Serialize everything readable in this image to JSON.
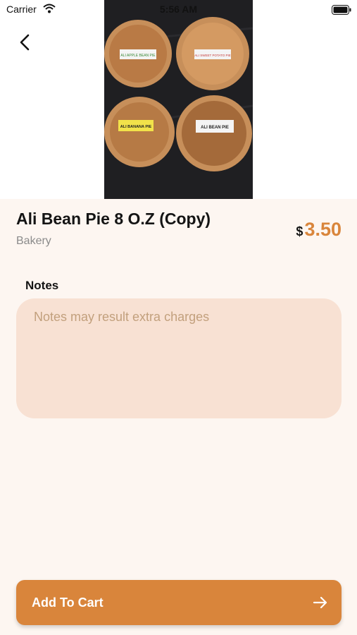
{
  "status_bar": {
    "carrier": "Carrier",
    "time": "5:56 AM",
    "icons": [
      "wifi-icon",
      "battery-icon"
    ]
  },
  "navigation": {
    "back_icon": "chevron-left-icon"
  },
  "product": {
    "title": "Ali Bean Pie 8 O.Z (Copy)",
    "category": "Bakery",
    "currency_symbol": "$",
    "price": "3.50",
    "photo_labels": [
      "ALI APPLE BEAN PIE",
      "ALI SWEET POTATO PIE",
      "ALI BANANA PIE",
      "ALI BEAN PIE"
    ]
  },
  "notes": {
    "label": "Notes",
    "placeholder": "Notes may result extra charges"
  },
  "cart_button": {
    "label": "Add To Cart",
    "icon": "arrow-right-icon"
  },
  "colors": {
    "accent": "#d9853b",
    "background": "#fdf6f1",
    "notes_fill": "#f8e1d3"
  }
}
